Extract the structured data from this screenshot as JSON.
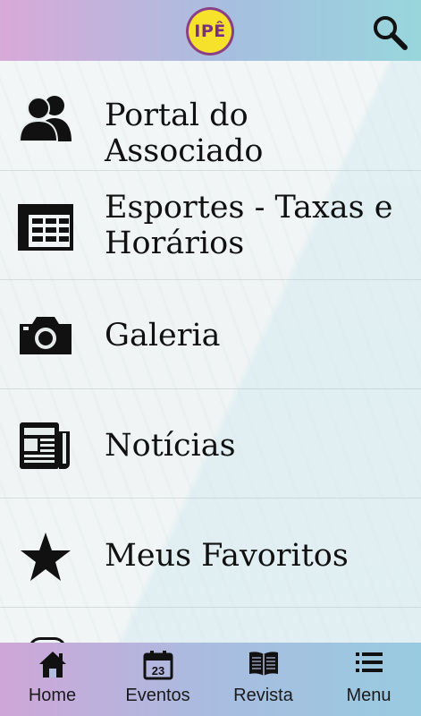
{
  "header": {
    "logo_text": "IPÊ",
    "search_icon": "search-icon",
    "colors": {
      "start": "#d9a9d8",
      "end": "#98d6dc"
    }
  },
  "menu": {
    "items": [
      {
        "label": "Portal do Associado",
        "icon": "users-icon"
      },
      {
        "label": "Esportes - Taxas e Horários",
        "icon": "table-icon"
      },
      {
        "label": "Galeria",
        "icon": "camera-icon"
      },
      {
        "label": "Notícias",
        "icon": "newspaper-icon"
      },
      {
        "label": "Meus Favoritos",
        "icon": "star-icon"
      }
    ]
  },
  "tabbar": {
    "tabs": [
      {
        "label": "Home",
        "icon": "home-icon"
      },
      {
        "label": "Eventos",
        "icon": "calendar-icon",
        "calendar_day": "23"
      },
      {
        "label": "Revista",
        "icon": "book-icon"
      },
      {
        "label": "Menu",
        "icon": "list-icon"
      }
    ]
  }
}
